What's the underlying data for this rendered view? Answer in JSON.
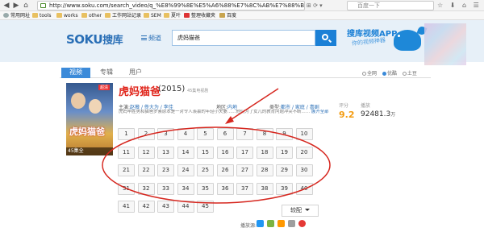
{
  "browser": {
    "url": "http://www.soku.com/search_video/q_%E8%99%8E%E5%A6%88%E7%8C%AB%E7%88%B8",
    "search_placeholder": "百度一下",
    "bookmarks": [
      "常用网址",
      "tools",
      "works",
      "other",
      "工作网站记录",
      "SEM",
      "夏叶",
      "整理收藏夹",
      "百度"
    ]
  },
  "header": {
    "logo_latin": "SOKU",
    "logo_cn": "搜库",
    "channel_label": "频道",
    "query": "虎妈猫爸",
    "promo_title": "搜库视频APP",
    "promo_sub": "你的视频神器"
  },
  "tabs": [
    "视频",
    "专辑",
    "用户"
  ],
  "filters": [
    "全网",
    "优酷",
    "土豆"
  ],
  "result": {
    "title": "虎妈猫爸",
    "year": "(2015)",
    "source_note": "45集电视剧",
    "poster_title": "虎妈猫爸",
    "poster_tag": "超清",
    "poster_eps": "45集全",
    "meta": {
      "cast_label": "主演:",
      "cast": "赵薇 / 佟大为 / 李佳",
      "region_label": "地区:",
      "region": "内地",
      "genre_label": "类型:",
      "genre": "都市 / 家庭 / 喜剧"
    },
    "description": "虎妈毕胜男和猫爸罗素原本是一对令人羡慕的年轻小夫妻……他们为了女儿的教育问题冲突不断……",
    "expand_label": "展开全部",
    "score_label": "评分",
    "score": "9.2",
    "plays_label": "播放",
    "plays": "92481.3",
    "plays_unit": "万"
  },
  "episodes": [
    "1",
    "2",
    "3",
    "4",
    "5",
    "6",
    "7",
    "8",
    "9",
    "10",
    "11",
    "12",
    "13",
    "14",
    "15",
    "16",
    "17",
    "18",
    "19",
    "20",
    "21",
    "22",
    "23",
    "24",
    "25",
    "26",
    "27",
    "28",
    "29",
    "30",
    "31",
    "32",
    "33",
    "34",
    "35",
    "36",
    "37",
    "38",
    "39",
    "40",
    "41",
    "42",
    "43",
    "44",
    "45"
  ],
  "more_button": "较配",
  "platform_label": "播放源:",
  "colors": {
    "accent": "#1b80d6",
    "title_red": "#e0251b",
    "score_orange": "#f39c12",
    "annotation_red": "#d6271f"
  }
}
